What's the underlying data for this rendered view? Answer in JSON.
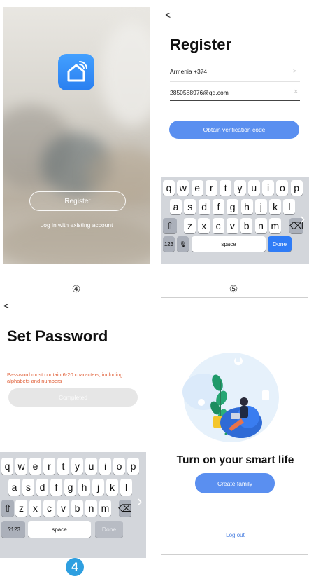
{
  "labels": {
    "step4": "④",
    "step5": "⑤",
    "badge": "4"
  },
  "splash": {
    "register_label": "Register",
    "login_link": "Log in with existing account",
    "logo_icon": "home-wifi-icon"
  },
  "register": {
    "back": "<",
    "title": "Register",
    "country": "Armenia +374",
    "country_chevron": ">",
    "email": "2850588976@qq.com",
    "clear": "×",
    "button": "Obtain verification code"
  },
  "keyboard": {
    "row1": [
      "q",
      "w",
      "e",
      "r",
      "t",
      "y",
      "u",
      "i",
      "o",
      "p"
    ],
    "row2": [
      "a",
      "s",
      "d",
      "f",
      "g",
      "h",
      "j",
      "k",
      "l"
    ],
    "row3": [
      "z",
      "x",
      "c",
      "v",
      "b",
      "n",
      "m"
    ],
    "shift": "⇧",
    "delete": "⌫",
    "num_key_register": "123",
    "num_key_password": ".?123",
    "mic": "🎙",
    "space": "space",
    "done": "Done",
    "side_arrow": "›"
  },
  "password": {
    "back": "<",
    "title": "Set Password",
    "hint": "Password must contain 6-20 characters, including alphabets and numbers",
    "button": "Completed"
  },
  "family": {
    "heading": "Turn on your smart life",
    "button": "Create family",
    "logout": "Log out"
  },
  "colors": {
    "accent": "#5a8ff0",
    "hint_red": "#e0613a",
    "badge": "#2e9fe0"
  }
}
